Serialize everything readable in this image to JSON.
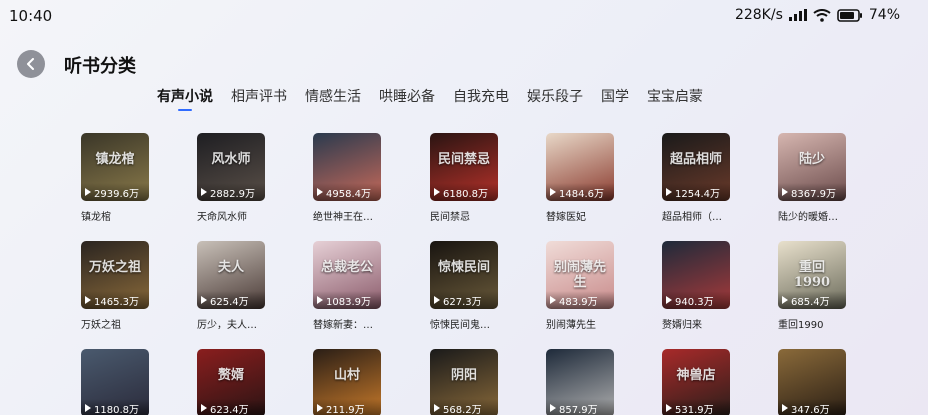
{
  "status_bar": {
    "time": "10:40",
    "speed": "228K/s",
    "battery": "74%"
  },
  "header": {
    "title": "听书分类",
    "back_icon": "chevron-left-icon"
  },
  "tabs": [
    {
      "label": "有声小说",
      "active": true
    },
    {
      "label": "相声评书",
      "active": false
    },
    {
      "label": "情感生活",
      "active": false
    },
    {
      "label": "哄睡必备",
      "active": false
    },
    {
      "label": "自我充电",
      "active": false
    },
    {
      "label": "娱乐段子",
      "active": false
    },
    {
      "label": "国学",
      "active": false
    },
    {
      "label": "宝宝启蒙",
      "active": false
    }
  ],
  "books": [
    {
      "title": "镇龙棺",
      "plays": "2939.6万",
      "cover_text": "镇龙棺",
      "colors": [
        "#3a3628",
        "#8a7a4a"
      ]
    },
    {
      "title": "天命风水师",
      "plays": "2882.9万",
      "cover_text": "风水师",
      "colors": [
        "#1e1e22",
        "#5a5048"
      ]
    },
    {
      "title": "绝世神王在…",
      "plays": "4958.4万",
      "cover_text": "",
      "colors": [
        "#2a3a4e",
        "#c86a5a"
      ]
    },
    {
      "title": "民间禁忌",
      "plays": "6180.8万",
      "cover_text": "民间禁忌",
      "colors": [
        "#2a1412",
        "#b8322a"
      ]
    },
    {
      "title": "替嫁医妃",
      "plays": "1484.6万",
      "cover_text": "",
      "colors": [
        "#e8d8c8",
        "#8a3a2e"
      ]
    },
    {
      "title": "超品相师（…",
      "plays": "1254.4万",
      "cover_text": "超品相师",
      "colors": [
        "#1a1a1a",
        "#6a3a2a"
      ]
    },
    {
      "title": "陆少的暖婚…",
      "plays": "8367.9万",
      "cover_text": "陆少",
      "colors": [
        "#d6b6b0",
        "#6a4a4a"
      ]
    },
    {
      "title": "万妖之祖",
      "plays": "1465.3万",
      "cover_text": "万妖之祖",
      "colors": [
        "#2a2420",
        "#8a6a3a"
      ]
    },
    {
      "title": "厉少，夫人…",
      "plays": "625.4万",
      "cover_text": "夫人",
      "colors": [
        "#c8c0b8",
        "#4a3a36"
      ]
    },
    {
      "title": "替嫁新妻：…",
      "plays": "1083.9万",
      "cover_text": "总裁老公",
      "colors": [
        "#e6d0d6",
        "#8a5a6a"
      ]
    },
    {
      "title": "惊悚民间鬼…",
      "plays": "627.3万",
      "cover_text": "惊悚民间",
      "colors": [
        "#181410",
        "#6a5a3a"
      ]
    },
    {
      "title": "别闹薄先生",
      "plays": "483.9万",
      "cover_text": "别闹薄先生",
      "colors": [
        "#f0dcd8",
        "#c88a8a"
      ]
    },
    {
      "title": "赘婿归来",
      "plays": "940.3万",
      "cover_text": "",
      "colors": [
        "#1e2a3a",
        "#a83a3a"
      ]
    },
    {
      "title": "重回1990",
      "plays": "685.4万",
      "cover_text": "重回1990",
      "colors": [
        "#e8e0cc",
        "#6a6a5a"
      ]
    },
    {
      "title": "",
      "plays": "1180.8万",
      "cover_text": "",
      "colors": [
        "#4a5a6e",
        "#2a2a3a"
      ]
    },
    {
      "title": "",
      "plays": "623.4万",
      "cover_text": "赘婿",
      "colors": [
        "#8a1e1e",
        "#2a1414"
      ]
    },
    {
      "title": "",
      "plays": "211.9万",
      "cover_text": "山村",
      "colors": [
        "#2a1e16",
        "#c87a2a"
      ]
    },
    {
      "title": "",
      "plays": "568.2万",
      "cover_text": "阴阳",
      "colors": [
        "#1a1a1a",
        "#8a6a3a"
      ]
    },
    {
      "title": "",
      "plays": "857.9万",
      "cover_text": "",
      "colors": [
        "#1e2a3a",
        "#b0b0b0"
      ]
    },
    {
      "title": "",
      "plays": "531.9万",
      "cover_text": "神兽店",
      "colors": [
        "#a82a2a",
        "#2a1e1a"
      ]
    },
    {
      "title": "",
      "plays": "347.6万",
      "cover_text": "",
      "colors": [
        "#8a6a3a",
        "#2a1e14"
      ]
    }
  ]
}
